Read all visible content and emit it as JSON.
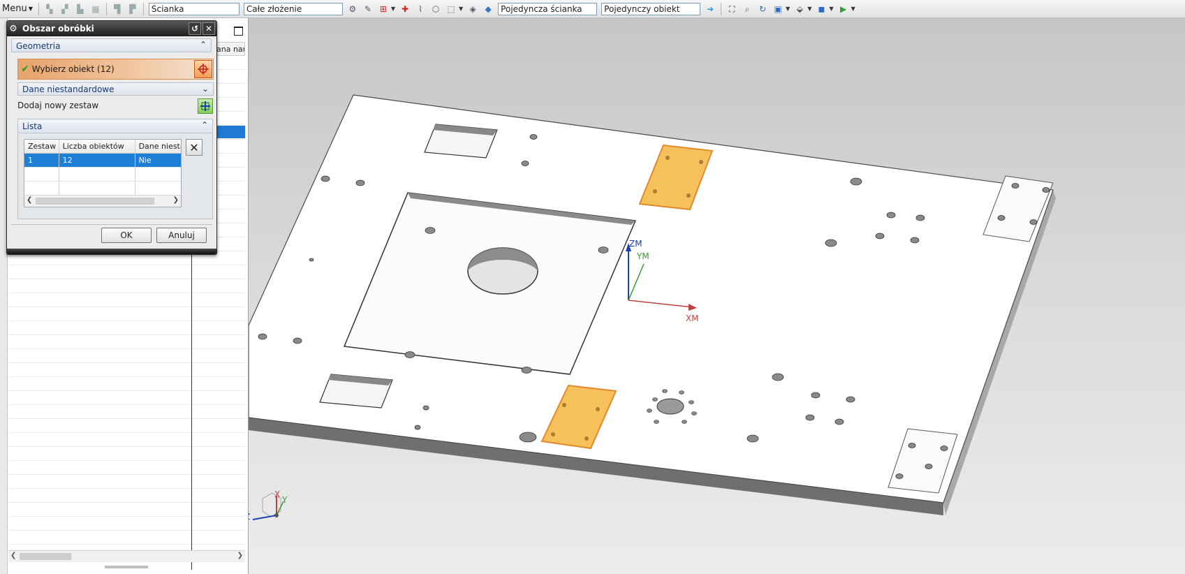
{
  "toolbar": {
    "menu_label": "Menu",
    "selection_filter": "Ścianka",
    "scope": "Całe złożenie",
    "face_rule": "Pojedyncza ścianka",
    "body_rule": "Pojedynczy obiekt"
  },
  "navigator": {
    "column_header": "ana nar"
  },
  "dialog": {
    "title": "Obszar obróbki",
    "geometry_group": "Geometria",
    "select_object_label": "Wybierz obiekt (12)",
    "custom_data_group": "Dane niestandardowe",
    "add_set_label": "Dodaj nowy zestaw",
    "list_group": "Lista",
    "list_columns": [
      "Zestaw",
      "Liczba obiektów",
      "Dane niesta"
    ],
    "list_rows": [
      [
        "1",
        "12",
        "Nie"
      ],
      [
        "",
        "",
        ""
      ],
      [
        "",
        "",
        ""
      ]
    ],
    "ok_label": "OK",
    "cancel_label": "Anuluj"
  },
  "viewport": {
    "wcs_labels": {
      "z": "ZM",
      "y": "YM",
      "x": "XM"
    },
    "triad_labels": {
      "z": "Z",
      "x": "X",
      "y": "Y"
    }
  },
  "colors": {
    "selection_highlight": "#f6c15a",
    "selected_row": "#1e7fd6",
    "accent_orange": "#e7a36a"
  }
}
